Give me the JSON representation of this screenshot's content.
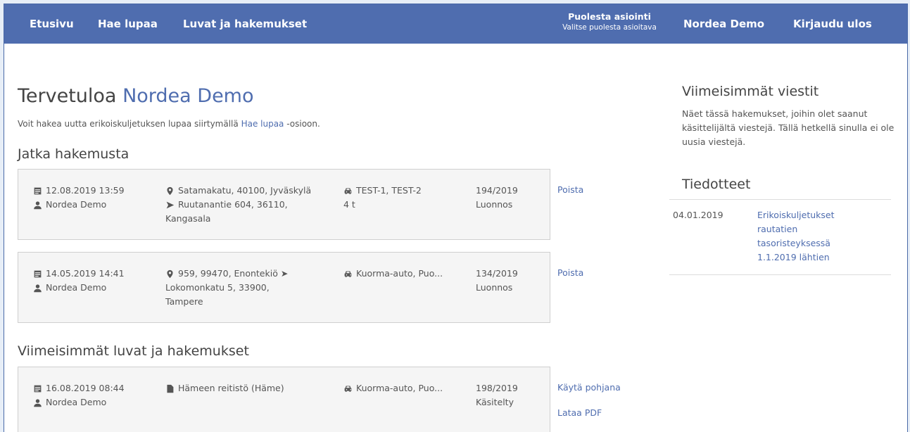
{
  "nav": {
    "home": "Etusivu",
    "apply": "Hae lupaa",
    "permits": "Luvat ja hakemukset",
    "proxy_title": "Puolesta asiointi",
    "proxy_sub": "Valitse puolesta asioitava",
    "user": "Nordea Demo",
    "logout": "Kirjaudu ulos"
  },
  "welcome": {
    "prefix": "Tervetuloa ",
    "name": "Nordea Demo",
    "intro_before": "Voit hakea uutta erikoiskuljetuksen lupaa siirtymällä ",
    "intro_link": "Hae lupaa",
    "intro_after": " -osioon."
  },
  "drafts": {
    "heading": "Jatka hakemusta",
    "items": [
      {
        "datetime": "12.08.2019 13:59",
        "user": "Nordea Demo",
        "route_lines": [
          "Satamakatu, 40100, Jyväskylä",
          "Ruutanantie 604, 36110,",
          "Kangasala"
        ],
        "vehicle": "TEST-1, TEST-2",
        "weight": "4 t",
        "number": "194/2019",
        "status": "Luonnos",
        "action": "Poista"
      },
      {
        "datetime": "14.05.2019 14:41",
        "user": "Nordea Demo",
        "route_lines": [
          "959, 99470, Enontekiö ➤",
          "Lokomonkatu 5, 33900,",
          "Tampere"
        ],
        "vehicle": "Kuorma-auto, Puo...",
        "number": "134/2019",
        "status": "Luonnos",
        "action": "Poista"
      }
    ]
  },
  "recent": {
    "heading": "Viimeisimmät luvat ja hakemukset",
    "items": [
      {
        "datetime": "16.08.2019 08:44",
        "user": "Nordea Demo",
        "route": "Hämeen reitistö (Häme)",
        "vehicle": "Kuorma-auto, Puo...",
        "number": "198/2019",
        "status": "Käsitelty",
        "action1": "Käytä pohjana",
        "action2": "Lataa PDF"
      }
    ]
  },
  "messages": {
    "heading": "Viimeisimmät viestit",
    "text": "Näet tässä hakemukset, joihin olet saanut käsittelijältä viestejä. Tällä hetkellä sinulla ei ole uusia viestejä."
  },
  "bulletins": {
    "heading": "Tiedotteet",
    "items": [
      {
        "date": "04.01.2019",
        "title": "Erikoiskuljetukset rautatien tasoristeyksessä 1.1.2019 lähtien"
      }
    ]
  },
  "colors": {
    "nav_bg": "#4f6daf",
    "link": "#4f6daf",
    "card_bg": "#f5f5f5"
  }
}
